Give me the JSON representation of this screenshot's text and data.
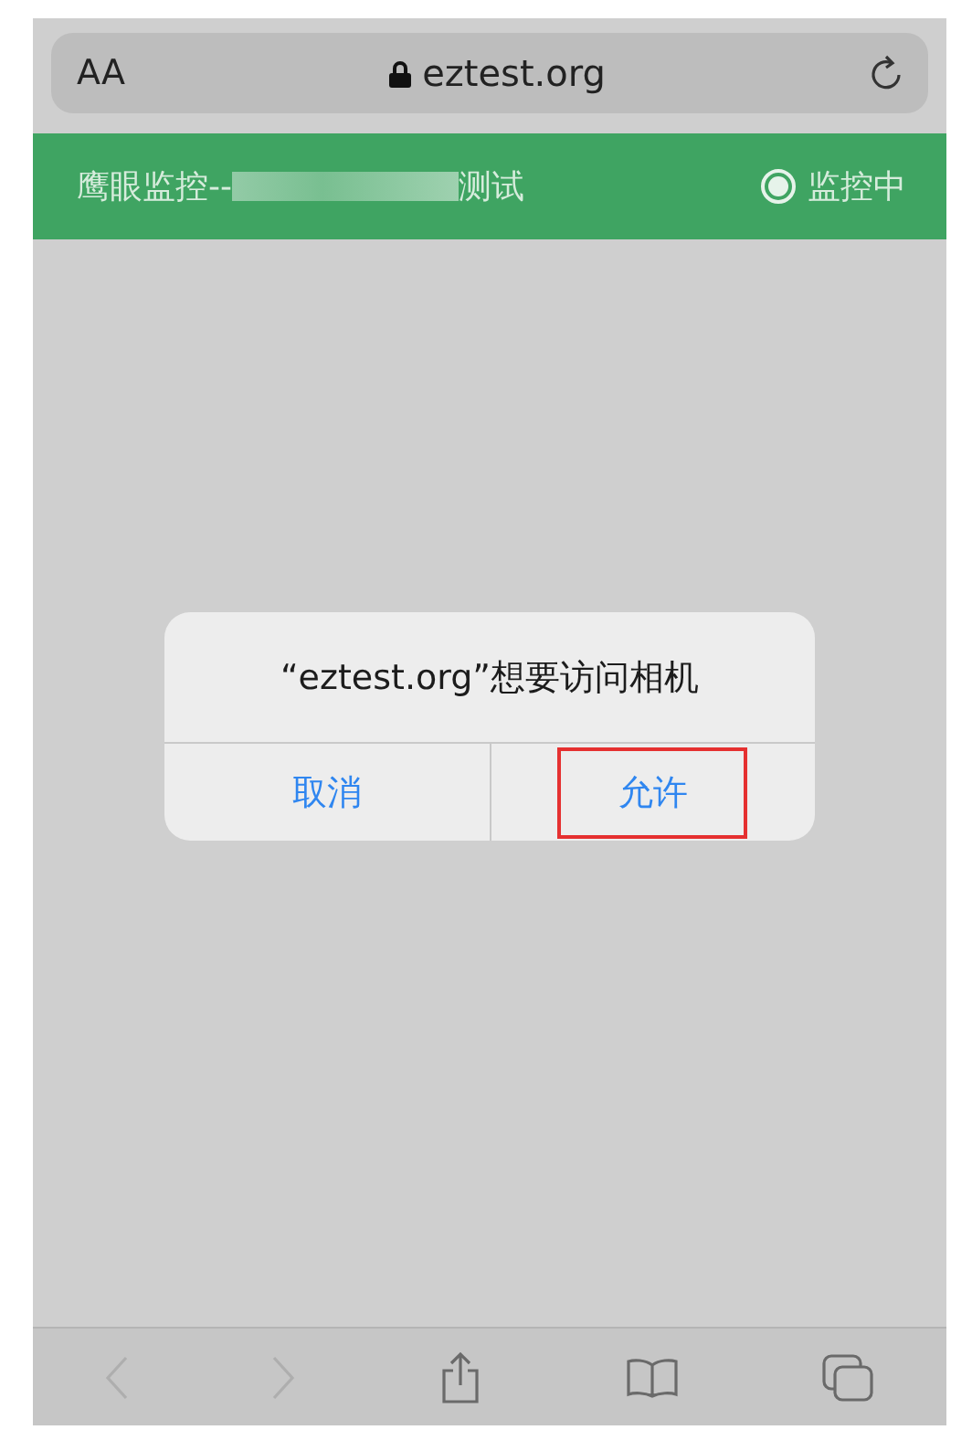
{
  "address_bar": {
    "text_size": "AA",
    "url": "eztest.org"
  },
  "header": {
    "title_prefix": "鹰眼监控--",
    "title_suffix": "测试",
    "status": {
      "label": "监控中",
      "on": true
    }
  },
  "dialog": {
    "message": "“eztest.org”想要访问相机",
    "buttons": [
      {
        "label": "取消",
        "highlighted": false
      },
      {
        "label": "允许",
        "highlighted": true
      }
    ]
  },
  "toolbar": {
    "back": {
      "disabled": true
    },
    "forward": {
      "disabled": true
    }
  }
}
